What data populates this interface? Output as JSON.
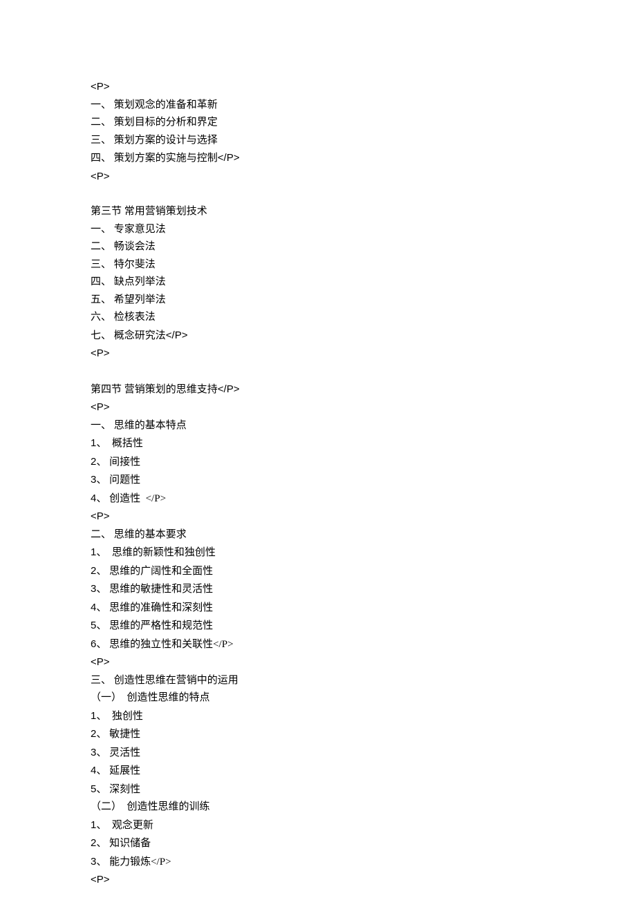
{
  "lines": [
    "<P>",
    "一、 策划观念的准备和革新",
    "二、 策划目标的分析和界定",
    "三、 策划方案的设计与选择",
    "四、 策划方案的实施与控制</P>",
    "<P>",
    "",
    "第三节 常用营销策划技术",
    "一、 专家意见法",
    "二、 畅谈会法",
    "三、 特尔斐法",
    "四、 缺点列举法",
    "五、 希望列举法",
    "六、 检核表法",
    "七、 概念研究法</P>",
    "<P>",
    "",
    "第四节 营销策划的思维支持</P>",
    "<P>",
    "一、 思维的基本特点",
    "1、  概括性",
    "2、 间接性",
    "3、 问题性",
    "4、 创造性  </P>",
    "<P>",
    "二、 思维的基本要求",
    "1、  思维的新颖性和独创性",
    "2、 思维的广阔性和全面性",
    "3、 思维的敏捷性和灵活性",
    "4、 思维的准确性和深刻性",
    "5、 思维的严格性和规范性",
    "6、 思维的独立性和关联性</P>",
    "<P>",
    "三、 创造性思维在营销中的运用",
    "（一）  创造性思维的特点",
    "1、  独创性",
    "2、 敏捷性",
    "3、 灵活性",
    "4、 延展性",
    "5、 深刻性",
    "（二）  创造性思维的训练",
    "1、  观念更新",
    "2、 知识储备",
    "3、 能力锻炼</P>",
    "<P>"
  ]
}
